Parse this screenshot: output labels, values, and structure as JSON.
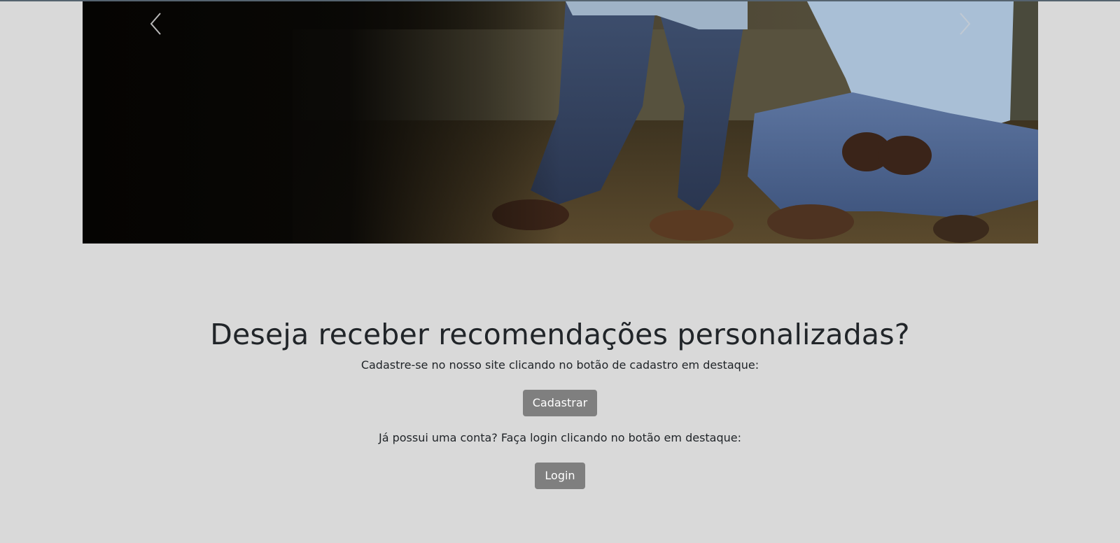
{
  "carousel": {
    "image": "photo of two men in denim prison uniforms sitting against a stone wall",
    "prev_icon": "chevron-left-icon",
    "next_icon": "chevron-right-icon"
  },
  "cta": {
    "title": "Deseja receber recomendações personalizadas?",
    "register_text": "Cadastre-se no nosso site clicando no botão de cadastro em destaque:",
    "register_button": "Cadastrar",
    "login_text": "Já possui uma conta? Faça login clicando no botão em destaque:",
    "login_button": "Login"
  },
  "colors": {
    "page_background": "#d9d9d9",
    "button_background": "#7f7f7f",
    "button_text": "#ffffff",
    "text": "#212529"
  }
}
